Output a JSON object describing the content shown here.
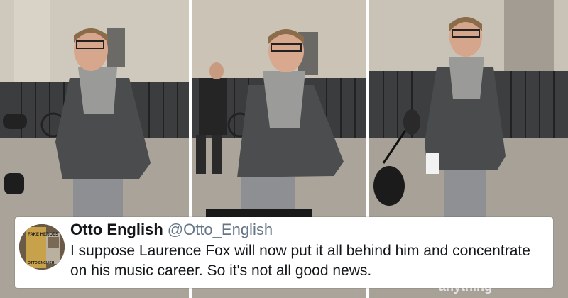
{
  "tweet": {
    "author_name": "Otto English",
    "username": "@Otto_English",
    "text": "I suppose Laurence Fox will now put it all behind him and concentrate on his music career. So it's not all good news.",
    "avatar_book_title": "FAKE HEROES",
    "avatar_book_author": "OTTO ENGLISH"
  },
  "overlay_text": "anything",
  "colors": {
    "background": "#ffffff",
    "author": "#14171a",
    "username": "#657786",
    "text": "#14171a"
  }
}
